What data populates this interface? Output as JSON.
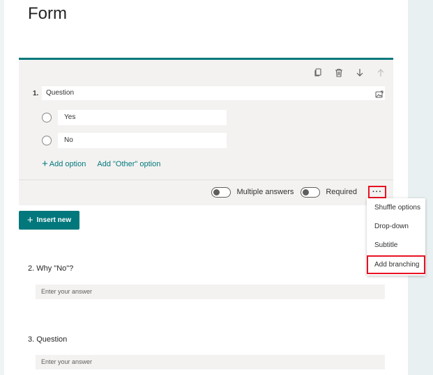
{
  "form": {
    "title": "Form"
  },
  "question1": {
    "number": "1.",
    "text": "Question",
    "options": [
      "Yes",
      "No"
    ],
    "add_option": "Add option",
    "add_other": "Add \"Other\" option",
    "toolbar_icons": [
      "copy-icon",
      "delete-icon",
      "move-down-icon",
      "move-up-icon"
    ],
    "toggles": {
      "multiple_answers": "Multiple answers",
      "required": "Required"
    },
    "more_label": "···"
  },
  "insert_new": "Insert new",
  "menu": {
    "items": [
      "Shuffle options",
      "Drop-down",
      "Subtitle",
      "Add branching"
    ],
    "highlighted": "Add branching"
  },
  "question2": {
    "title": "2. Why \"No\"?",
    "placeholder": "Enter your answer"
  },
  "question3": {
    "title": "3. Question",
    "placeholder": "Enter your answer"
  },
  "colors": {
    "accent": "#03787c",
    "highlight": "#e81123"
  }
}
